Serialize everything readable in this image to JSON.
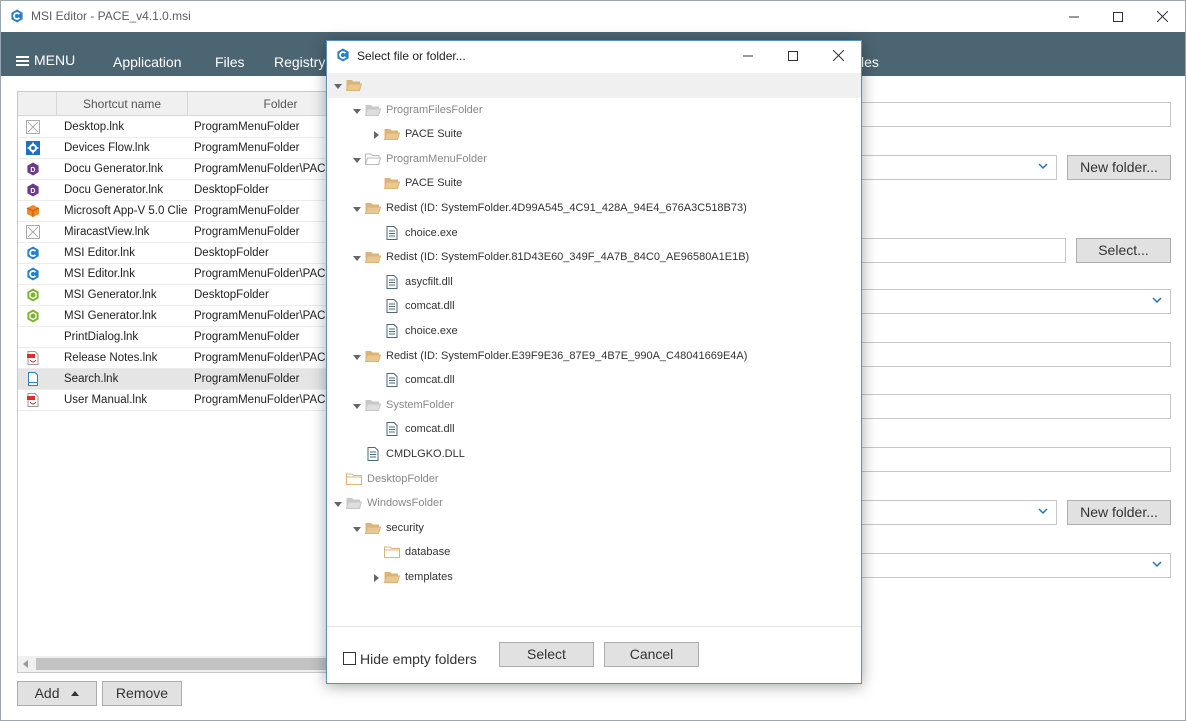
{
  "window": {
    "title": "MSI Editor - PACE_v4.1.0.msi",
    "controls": {
      "minimize": "minimize-icon",
      "maximize": "maximize-icon",
      "close": "close-icon"
    }
  },
  "menubar": {
    "menu_label": "MENU",
    "items": [
      "Application",
      "Files",
      "Registry",
      "les"
    ]
  },
  "table": {
    "columns": [
      "Shortcut name",
      "Folder"
    ],
    "rows": [
      {
        "name": "Desktop.lnk",
        "folder": "ProgramMenuFolder",
        "icon": "generic-x-icon"
      },
      {
        "name": "Devices Flow.lnk",
        "folder": "ProgramMenuFolder",
        "icon": "gear-app-icon"
      },
      {
        "name": "Docu Generator.lnk",
        "folder": "ProgramMenuFolder\\PACE",
        "icon": "docu-generator-icon"
      },
      {
        "name": "Docu Generator.lnk",
        "folder": "DesktopFolder",
        "icon": "docu-generator-icon"
      },
      {
        "name": "Microsoft App-V 5.0 Clie",
        "folder": "ProgramMenuFolder",
        "icon": "appv-icon"
      },
      {
        "name": "MiracastView.lnk",
        "folder": "ProgramMenuFolder",
        "icon": "generic-x-icon"
      },
      {
        "name": "MSI Editor.lnk",
        "folder": "DesktopFolder",
        "icon": "msi-editor-icon"
      },
      {
        "name": "MSI Editor.lnk",
        "folder": "ProgramMenuFolder\\PACE",
        "icon": "msi-editor-icon"
      },
      {
        "name": "MSI Generator.lnk",
        "folder": "DesktopFolder",
        "icon": "msi-generator-icon"
      },
      {
        "name": "MSI Generator.lnk",
        "folder": "ProgramMenuFolder\\PACE",
        "icon": "msi-generator-icon"
      },
      {
        "name": "PrintDialog.lnk",
        "folder": "ProgramMenuFolder",
        "icon": "none"
      },
      {
        "name": "Release Notes.lnk",
        "folder": "ProgramMenuFolder\\PACE",
        "icon": "pdf-icon"
      },
      {
        "name": "Search.lnk",
        "folder": "ProgramMenuFolder",
        "icon": "document-icon"
      },
      {
        "name": "User Manual.lnk",
        "folder": "ProgramMenuFolder\\PACE",
        "icon": "pdf-icon"
      }
    ],
    "selected_row": "Search.lnk"
  },
  "buttons": {
    "add": "Add",
    "remove": "Remove",
    "new_folder_1": "New folder...",
    "select_right": "Select...",
    "new_folder_2": "New folder..."
  },
  "dialog": {
    "title": "Select file or folder...",
    "tree": [
      {
        "label": "",
        "kind": "folder-open"
      },
      {
        "label": "ProgramFilesFolder",
        "kind": "folder-open-grey"
      },
      {
        "label": "PACE Suite",
        "kind": "folder-open"
      },
      {
        "label": "ProgramMenuFolder",
        "kind": "folder-open-empty"
      },
      {
        "label": "PACE Suite",
        "kind": "folder-open"
      },
      {
        "label": "Redist (ID: SystemFolder.4D99A545_4C91_428A_94E4_676A3C518B73)",
        "kind": "folder-open"
      },
      {
        "label": "choice.exe",
        "kind": "file"
      },
      {
        "label": "Redist (ID: SystemFolder.81D43E60_349F_4A7B_84C0_AE96580A1E1B)",
        "kind": "folder-open"
      },
      {
        "label": "asycfilt.dll",
        "kind": "file"
      },
      {
        "label": "comcat.dll",
        "kind": "file"
      },
      {
        "label": "choice.exe",
        "kind": "file"
      },
      {
        "label": "Redist (ID: SystemFolder.E39F9E36_87E9_4B7E_990A_C48041669E4A)",
        "kind": "folder-open"
      },
      {
        "label": "comcat.dll",
        "kind": "file"
      },
      {
        "label": "SystemFolder",
        "kind": "folder-open-grey"
      },
      {
        "label": "comcat.dll",
        "kind": "file"
      },
      {
        "label": "CMDLGKO.DLL",
        "kind": "file"
      },
      {
        "label": "DesktopFolder",
        "kind": "folder-empty"
      },
      {
        "label": "WindowsFolder",
        "kind": "folder-open-grey"
      },
      {
        "label": "security",
        "kind": "folder-open"
      },
      {
        "label": "database",
        "kind": "folder-empty"
      },
      {
        "label": "templates",
        "kind": "folder-open"
      }
    ],
    "hide_empty_label": "Hide empty folders",
    "hide_empty_checked": false,
    "select_label": "Select",
    "cancel_label": "Cancel"
  },
  "colors": {
    "menubar": "#4c6572",
    "folder": "#dcb47a",
    "accent": "#1f73b7"
  }
}
